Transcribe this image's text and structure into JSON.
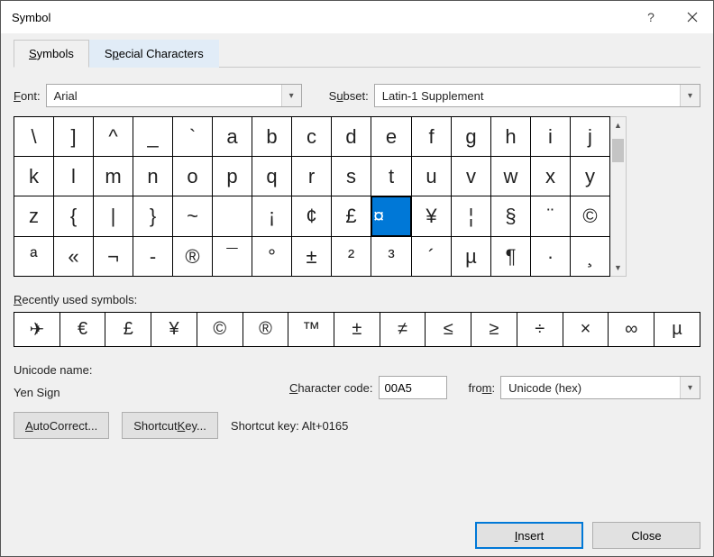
{
  "titlebar": {
    "title": "Symbol"
  },
  "tabs": {
    "symbols": "Symbols",
    "special": "Special Characters"
  },
  "labels": {
    "font": "Font:",
    "subset": "Subset:",
    "recently": "Recently used symbols:",
    "unicode_name": "Unicode name:",
    "char_code": "Character code:",
    "from": "from:",
    "autocorrect": "AutoCorrect...",
    "shortcut_key": "Shortcut Key...",
    "shortcut_key_label": "Shortcut key:"
  },
  "font": {
    "value": "Arial"
  },
  "subset": {
    "value": "Latin-1 Supplement"
  },
  "grid": {
    "cols": 15,
    "selected_index": 39,
    "cells": [
      "\\",
      "]",
      "^",
      "_",
      "`",
      "a",
      "b",
      "c",
      "d",
      "e",
      "f",
      "g",
      "h",
      "i",
      "j",
      "k",
      "l",
      "m",
      "n",
      "o",
      "p",
      "q",
      "r",
      "s",
      "t",
      "u",
      "v",
      "w",
      "x",
      "y",
      "z",
      "{",
      "|",
      "}",
      "~",
      "",
      "¡",
      "¢",
      "£",
      "¤",
      "¥",
      "¦",
      "§",
      "¨",
      "©",
      "ª",
      "«",
      "¬",
      "­-",
      "®",
      "¯",
      "°",
      "±",
      "²",
      "³",
      "´",
      "µ",
      "¶",
      "·",
      "¸"
    ]
  },
  "recent": [
    "✈",
    "€",
    "£",
    "¥",
    "©",
    "®",
    "™",
    "±",
    "≠",
    "≤",
    "≥",
    "÷",
    "×",
    "∞",
    "µ"
  ],
  "unicode_name_value": "Yen Sign",
  "char_code": "00A5",
  "from": {
    "value": "Unicode (hex)"
  },
  "shortcut_value": "Alt+0165",
  "footer": {
    "insert": "Insert",
    "close": "Close"
  }
}
